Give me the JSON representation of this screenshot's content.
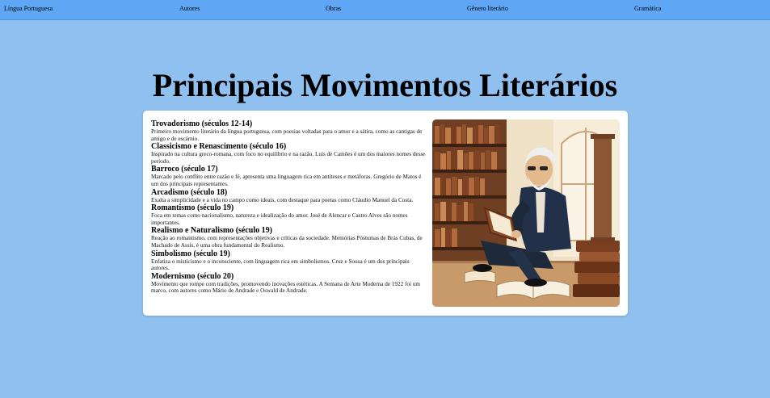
{
  "nav": {
    "items": [
      {
        "label": "Língua Portuguesa"
      },
      {
        "label": "Autores"
      },
      {
        "label": "Obras"
      },
      {
        "label": "Gênero literário"
      },
      {
        "label": "Gramática"
      }
    ]
  },
  "main": {
    "title": "Principais Movimentos Literários",
    "movements": [
      {
        "title": "Trovadorismo (séculos 12-14)",
        "desc": "Primeiro movimento literário da língua portuguesa, com poesias voltadas para o amor e a sátira, como as cantigas de amigo e de escárnio."
      },
      {
        "title": "Classicismo e Renascimento (século 16)",
        "desc": "Inspirado na cultura greco-romana, com foco no equilíbrio e na razão. Luís de Camões é um dos maiores nomes desse período."
      },
      {
        "title": "Barroco (século 17)",
        "desc": "Marcado pelo conflito entre razão e fé, apresenta uma linguagem rica em antíteses e metáforas. Gregório de Matos é um dos principais representantes."
      },
      {
        "title": "Arcadismo (século 18)",
        "desc": "Exalta a simplicidade e a vida no campo como ideais, com destaque para poetas como Cláudio Manuel da Costa."
      },
      {
        "title": "Romantismo (século 19)",
        "desc": "Foca em temas como nacionalismo, natureza e idealização do amor. José de Alencar e Castro Alves são nomes importantes."
      },
      {
        "title": "Realismo e Naturalismo (século 19)",
        "desc": "Reação ao romantismo, com representações objetivas e críticas da sociedade. Memórias Póstumas de Brás Cubas, de Machado de Assis, é uma obra fundamental do Realismo."
      },
      {
        "title": "Simbolismo (século 19)",
        "desc": "Enfatiza o misticismo e o inconsciente, com linguagem rica em simbolismos. Cruz e Sousa é um dos principais autores."
      },
      {
        "title": "Modernismo (século 20)",
        "desc": "Movimento que rompe com tradições, promovendo inovações estéticas. A Semana de Arte Moderna de 1922 foi um marco, com autores como Mário de Andrade e Oswald de Andrade."
      }
    ]
  },
  "colors": {
    "page_background": "#8fc0ef",
    "nav_background": "#5fa6f5",
    "card_background": "#ffffff"
  }
}
